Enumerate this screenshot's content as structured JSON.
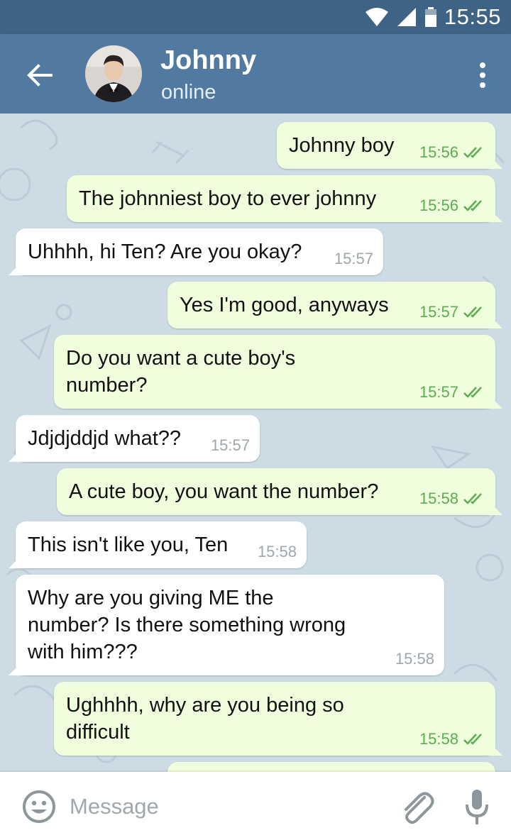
{
  "status_bar": {
    "time": "15:55"
  },
  "header": {
    "name": "Johnny",
    "status": "online"
  },
  "messages": [
    {
      "dir": "out",
      "text": "Johnny boy",
      "time": "15:56"
    },
    {
      "dir": "out",
      "text": "The johnniest boy to ever johnny",
      "time": "15:56"
    },
    {
      "dir": "in",
      "text": "Uhhhh, hi Ten? Are you okay?",
      "time": "15:57"
    },
    {
      "dir": "out",
      "text": "Yes I'm good, anyways",
      "time": "15:57"
    },
    {
      "dir": "out",
      "text": "Do you want a cute boy's\nnumber?",
      "time": "15:57"
    },
    {
      "dir": "in",
      "text": "Jdjdjddjd what??",
      "time": "15:57"
    },
    {
      "dir": "out",
      "text": "A cute boy, you want the number?",
      "time": "15:58"
    },
    {
      "dir": "in",
      "text": "This isn't like you, Ten",
      "time": "15:58"
    },
    {
      "dir": "in",
      "text": "Why are you giving ME the\nnumber? Is there something wrong\nwith him???",
      "time": "15:58"
    },
    {
      "dir": "out",
      "text": "Ughhhh, why are you being so\ndifficult",
      "time": "15:58"
    }
  ],
  "composer": {
    "placeholder": "Message"
  },
  "colors": {
    "status_bar": "#3f6384",
    "header": "#5279a0",
    "chat_background": "#cddbe4",
    "outgoing_bubble": "#effedd",
    "incoming_bubble": "#ffffff",
    "outgoing_time": "#5cad4f"
  },
  "icons": {
    "back": "arrow-left-icon",
    "menu": "more-vertical-icon",
    "emoji": "smile-icon",
    "attach": "paperclip-icon",
    "mic": "microphone-icon",
    "read_receipt": "double-check-icon"
  }
}
